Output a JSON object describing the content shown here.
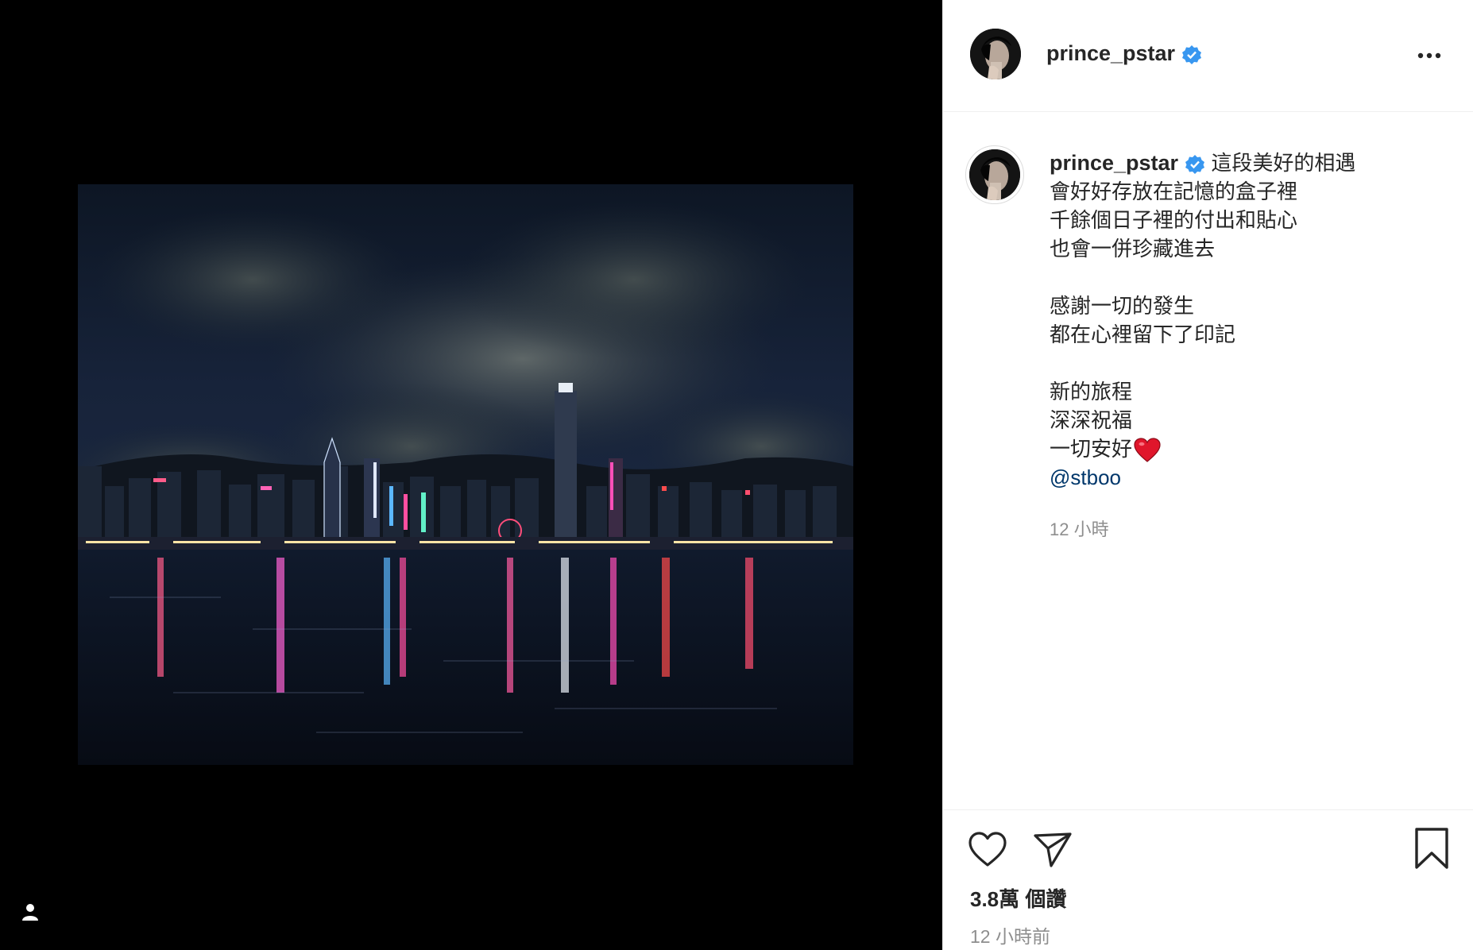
{
  "post": {
    "username": "prince_pstar",
    "verified": true,
    "caption": {
      "first_line": "這段美好的相遇",
      "lines": [
        "會好好存放在記憶的盒子裡",
        "千餘個日子裡的付出和貼心",
        "也會一併珍藏進去",
        "",
        "感謝一切的發生",
        "都在心裡留下了印記",
        "",
        "新的旅程",
        "深深祝福"
      ],
      "last_line": "一切安好",
      "mention": "@stboo"
    },
    "caption_time": "12 小時",
    "likes": "3.8萬 個讚",
    "post_time": "12 小時前",
    "image_subject": "Hong Kong skyline at night over Victoria Harbour"
  },
  "icons": {
    "more": "more-options-icon",
    "like": "heart-outline-icon",
    "share": "paper-plane-icon",
    "save": "bookmark-icon",
    "tag_people": "user-icon",
    "verified": "verified-badge-icon"
  },
  "colors": {
    "verified": "#3897f0",
    "mention": "#00376b",
    "muted": "#8e8e8e",
    "text": "#262626"
  }
}
